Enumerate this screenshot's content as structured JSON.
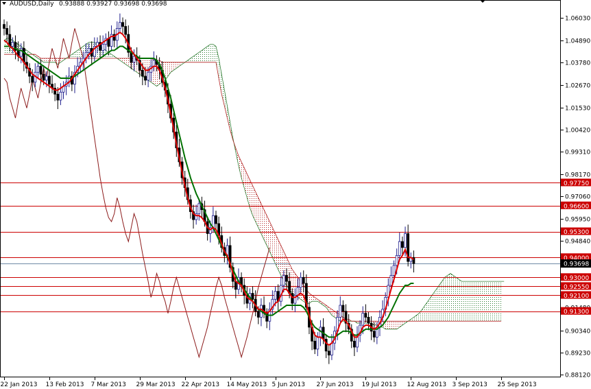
{
  "header": {
    "symbol": "AUDUSD,Daily",
    "ohlc": "0.93888 0.93927 0.93698 0.93698"
  },
  "colors": {
    "background": "#ffffff",
    "axis": "#000000",
    "level_line": "#cc0000",
    "level_label_bg": "#cc0000",
    "current_label_bg": "#000000",
    "current_line": "#6e8aa6",
    "candle_up": "#1c1c8c",
    "candle_down": "#000000",
    "tenkan": "#dd0000",
    "kijun": "#007000",
    "chikou": "#8b1a1a",
    "kumo_bear": "#b22222",
    "kumo_bull": "#2e7d32"
  },
  "chart_data": {
    "type": "candlestick",
    "title": "AUDUSD,Daily",
    "ylim": [
      0.8812,
      1.0672
    ],
    "y_ticks": [
      {
        "v": 1.0603,
        "label": "1.06030"
      },
      {
        "v": 1.0489,
        "label": "1.04890"
      },
      {
        "v": 1.0378,
        "label": "1.03780"
      },
      {
        "v": 1.0267,
        "label": "1.02670"
      },
      {
        "v": 1.0153,
        "label": "1.01530"
      },
      {
        "v": 1.0042,
        "label": "1.00420"
      },
      {
        "v": 0.9931,
        "label": "0.99310"
      },
      {
        "v": 0.9817,
        "label": "0.98170"
      },
      {
        "v": 0.9706,
        "label": "0.97060"
      },
      {
        "v": 0.9595,
        "label": "0.95950"
      },
      {
        "v": 0.9484,
        "label": "0.94840"
      },
      {
        "v": 0.937,
        "label": "0.93700"
      },
      {
        "v": 0.9259,
        "label": "0.92590"
      },
      {
        "v": 0.9148,
        "label": "0.91480"
      },
      {
        "v": 0.9034,
        "label": "0.90340"
      },
      {
        "v": 0.8923,
        "label": "0.89230"
      },
      {
        "v": 0.8812,
        "label": "0.88120"
      }
    ],
    "x_labels": [
      {
        "i": 0,
        "label": "22 Jan 2013"
      },
      {
        "i": 16,
        "label": "13 Feb 2013"
      },
      {
        "i": 32,
        "label": "7 Mar 2013"
      },
      {
        "i": 48,
        "label": "29 Mar 2013"
      },
      {
        "i": 64,
        "label": "22 Apr 2013"
      },
      {
        "i": 80,
        "label": "14 May 2013"
      },
      {
        "i": 96,
        "label": "5 Jun 2013"
      },
      {
        "i": 112,
        "label": "27 Jun 2013"
      },
      {
        "i": 128,
        "label": "19 Jul 2013"
      },
      {
        "i": 144,
        "label": "12 Aug 2013"
      },
      {
        "i": 160,
        "label": "3 Sep 2013"
      },
      {
        "i": 176,
        "label": "25 Sep 2013"
      }
    ],
    "levels": [
      {
        "v": 0.9775,
        "label": "0.97750"
      },
      {
        "v": 0.966,
        "label": "0.96600"
      },
      {
        "v": 0.953,
        "label": "0.95300"
      },
      {
        "v": 0.94,
        "label": "0.94000"
      },
      {
        "v": 0.93,
        "label": "0.93000"
      },
      {
        "v": 0.9255,
        "label": "0.92550"
      },
      {
        "v": 0.921,
        "label": "0.92100"
      },
      {
        "v": 0.913,
        "label": "0.91300"
      }
    ],
    "current": {
      "v": 0.93698,
      "label": "0.93698"
    },
    "closes": [
      1.055,
      1.052,
      1.046,
      1.048,
      1.044,
      1.041,
      1.045,
      1.038,
      1.035,
      1.031,
      1.028,
      1.033,
      1.036,
      1.032,
      1.029,
      1.031,
      1.027,
      1.025,
      1.022,
      1.019,
      1.023,
      1.026,
      1.028,
      1.031,
      1.027,
      1.033,
      1.036,
      1.038,
      1.04,
      1.043,
      1.045,
      1.041,
      1.046,
      1.048,
      1.044,
      1.047,
      1.05,
      1.046,
      1.052,
      1.049,
      1.055,
      1.058,
      1.056,
      1.052,
      1.043,
      1.038,
      1.041,
      1.039,
      1.034,
      1.031,
      1.029,
      1.033,
      1.036,
      1.039,
      1.037,
      1.034,
      1.028,
      1.024,
      1.017,
      1.01,
      1.003,
      0.995,
      0.988,
      0.98,
      0.975,
      0.969,
      0.963,
      0.959,
      0.962,
      0.967,
      0.964,
      0.958,
      0.952,
      0.955,
      0.961,
      0.957,
      0.951,
      0.945,
      0.941,
      0.946,
      0.935,
      0.928,
      0.924,
      0.93,
      0.926,
      0.921,
      0.917,
      0.922,
      0.919,
      0.913,
      0.91,
      0.916,
      0.912,
      0.908,
      0.914,
      0.919,
      0.923,
      0.918,
      0.926,
      0.931,
      0.928,
      0.922,
      0.917,
      0.921,
      0.925,
      0.93,
      0.927,
      0.915,
      0.905,
      0.898,
      0.894,
      0.9,
      0.905,
      0.899,
      0.893,
      0.891,
      0.897,
      0.903,
      0.91,
      0.916,
      0.913,
      0.907,
      0.904,
      0.898,
      0.895,
      0.901,
      0.906,
      0.912,
      0.91,
      0.907,
      0.903,
      0.9,
      0.905,
      0.91,
      0.914,
      0.92,
      0.926,
      0.931,
      0.936,
      0.941,
      0.948,
      0.945,
      0.952,
      0.938,
      0.94,
      0.937
    ],
    "tenkan": [
      1.049,
      1.048,
      1.046,
      1.045,
      1.043,
      1.041,
      1.04,
      1.038,
      1.036,
      1.034,
      1.032,
      1.031,
      1.03,
      1.029,
      1.028,
      1.027,
      1.026,
      1.025,
      1.024,
      1.024,
      1.025,
      1.026,
      1.027,
      1.028,
      1.03,
      1.032,
      1.034,
      1.036,
      1.038,
      1.04,
      1.042,
      1.043,
      1.045,
      1.046,
      1.047,
      1.048,
      1.049,
      1.05,
      1.051,
      1.051,
      1.052,
      1.053,
      1.052,
      1.05,
      1.047,
      1.044,
      1.042,
      1.04,
      1.038,
      1.036,
      1.034,
      1.034,
      1.035,
      1.036,
      1.036,
      1.034,
      1.03,
      1.025,
      1.019,
      1.012,
      1.005,
      0.997,
      0.99,
      0.983,
      0.976,
      0.97,
      0.965,
      0.962,
      0.961,
      0.961,
      0.96,
      0.958,
      0.955,
      0.954,
      0.955,
      0.954,
      0.951,
      0.947,
      0.943,
      0.941,
      0.937,
      0.932,
      0.928,
      0.927,
      0.926,
      0.923,
      0.92,
      0.919,
      0.918,
      0.916,
      0.914,
      0.914,
      0.913,
      0.912,
      0.913,
      0.915,
      0.917,
      0.918,
      0.921,
      0.924,
      0.924,
      0.922,
      0.92,
      0.92,
      0.921,
      0.922,
      0.921,
      0.917,
      0.911,
      0.905,
      0.901,
      0.9,
      0.9,
      0.899,
      0.897,
      0.896,
      0.897,
      0.899,
      0.903,
      0.907,
      0.909,
      0.908,
      0.906,
      0.903,
      0.9,
      0.9,
      0.902,
      0.905,
      0.906,
      0.906,
      0.905,
      0.904,
      0.905,
      0.907,
      0.91,
      0.914,
      0.919,
      0.924,
      0.929,
      0.934,
      0.939,
      0.941,
      0.944,
      0.94,
      0.94,
      0.939
    ],
    "kijun": [
      1.046,
      1.046,
      1.046,
      1.045,
      1.045,
      1.044,
      1.044,
      1.043,
      1.042,
      1.041,
      1.04,
      1.039,
      1.038,
      1.037,
      1.036,
      1.035,
      1.034,
      1.033,
      1.032,
      1.031,
      1.03,
      1.03,
      1.03,
      1.03,
      1.03,
      1.031,
      1.032,
      1.033,
      1.034,
      1.035,
      1.036,
      1.037,
      1.038,
      1.039,
      1.04,
      1.041,
      1.042,
      1.043,
      1.044,
      1.044,
      1.045,
      1.046,
      1.046,
      1.045,
      1.044,
      1.043,
      1.042,
      1.041,
      1.04,
      1.04,
      1.04,
      1.04,
      1.04,
      1.04,
      1.039,
      1.037,
      1.034,
      1.03,
      1.025,
      1.02,
      1.014,
      1.008,
      1.002,
      0.996,
      0.99,
      0.985,
      0.98,
      0.976,
      0.972,
      0.969,
      0.966,
      0.963,
      0.96,
      0.957,
      0.955,
      0.952,
      0.949,
      0.946,
      0.943,
      0.94,
      0.937,
      0.934,
      0.931,
      0.928,
      0.926,
      0.924,
      0.922,
      0.92,
      0.918,
      0.916,
      0.914,
      0.913,
      0.912,
      0.911,
      0.911,
      0.911,
      0.912,
      0.913,
      0.914,
      0.915,
      0.916,
      0.916,
      0.916,
      0.916,
      0.916,
      0.916,
      0.915,
      0.913,
      0.91,
      0.907,
      0.905,
      0.904,
      0.903,
      0.902,
      0.901,
      0.9,
      0.9,
      0.9,
      0.901,
      0.902,
      0.903,
      0.903,
      0.903,
      0.902,
      0.901,
      0.901,
      0.902,
      0.903,
      0.904,
      0.904,
      0.904,
      0.904,
      0.904,
      0.905,
      0.906,
      0.908,
      0.91,
      0.913,
      0.916,
      0.919,
      0.922,
      0.924,
      0.926,
      0.926,
      0.927,
      0.927
    ],
    "chikou": [
      1.03,
      1.028,
      1.02,
      1.015,
      1.01,
      1.018,
      1.025,
      1.02,
      1.015,
      1.022,
      1.03,
      1.025,
      1.02,
      1.028,
      1.035,
      1.03,
      1.038,
      1.045,
      1.04,
      1.035,
      1.042,
      1.05,
      1.045,
      1.04,
      1.048,
      1.055,
      1.05,
      1.045,
      1.04,
      1.03,
      1.02,
      1.01,
      1.0,
      0.99,
      0.98,
      0.972,
      0.965,
      0.96,
      0.958,
      0.962,
      0.97,
      0.965,
      0.958,
      0.952,
      0.948,
      0.955,
      0.962,
      0.958,
      0.95,
      0.942,
      0.935,
      0.928,
      0.92,
      0.925,
      0.932,
      0.928,
      0.922,
      0.918,
      0.912,
      0.918,
      0.925,
      0.93,
      0.925,
      0.92,
      0.915,
      0.91,
      0.905,
      0.9,
      0.895,
      0.89,
      0.895,
      0.9,
      0.905,
      0.912,
      0.918,
      0.925,
      0.93,
      0.926,
      0.92,
      0.915,
      0.91,
      0.905,
      0.9,
      0.895,
      0.89,
      0.895,
      0.9,
      0.906,
      0.912,
      0.918,
      0.925,
      0.93,
      0.935,
      0.94,
      0.945
    ],
    "span_a": [
      1.049,
      1.05,
      1.05,
      1.049,
      1.048,
      1.047,
      1.046,
      1.045,
      1.044,
      1.043,
      1.042,
      1.041,
      1.04,
      1.039,
      1.038,
      1.038,
      1.038,
      1.038,
      1.038,
      1.037,
      1.038,
      1.039,
      1.04,
      1.041,
      1.042,
      1.043,
      1.044,
      1.045,
      1.046,
      1.047,
      1.048,
      1.048,
      1.048,
      1.047,
      1.046,
      1.045,
      1.044,
      1.043,
      1.042,
      1.041,
      1.04,
      1.039,
      1.038,
      1.037,
      1.036,
      1.035,
      1.034,
      1.033,
      1.032,
      1.031,
      1.03,
      1.029,
      1.028,
      1.027,
      1.026,
      1.027,
      1.028,
      1.029,
      1.031,
      1.033,
      1.034,
      1.035,
      1.036,
      1.037,
      1.038,
      1.039,
      1.04,
      1.041,
      1.042,
      1.043,
      1.044,
      1.045,
      1.046,
      1.047,
      1.047,
      1.046,
      1.04,
      1.032,
      1.024,
      1.016,
      1.008,
      1.0,
      0.993,
      0.986,
      0.98,
      0.975,
      0.97,
      0.965,
      0.961,
      0.958,
      0.955,
      0.952,
      0.949,
      0.946,
      0.943,
      0.94,
      0.937,
      0.934,
      0.931,
      0.928,
      0.926,
      0.924,
      0.922,
      0.921,
      0.92,
      0.919,
      0.918,
      0.917,
      0.917,
      0.918,
      0.918,
      0.918,
      0.917,
      0.916,
      0.915,
      0.913,
      0.911,
      0.91,
      0.909,
      0.908,
      0.908,
      0.908,
      0.908,
      0.908,
      0.908,
      0.907,
      0.907,
      0.907,
      0.907,
      0.907,
      0.907,
      0.906,
      0.906,
      0.905,
      0.905,
      0.904,
      0.904,
      0.904,
      0.904,
      0.904,
      0.905,
      0.906,
      0.907,
      0.908,
      0.909,
      0.91,
      0.911,
      0.912,
      0.914,
      0.916,
      0.918,
      0.92,
      0.922,
      0.924,
      0.926,
      0.928,
      0.93,
      0.931,
      0.932,
      0.931,
      0.93,
      0.929,
      0.928,
      0.928,
      0.928,
      0.928,
      0.928,
      0.928,
      0.928,
      0.928,
      0.928,
      0.928,
      0.928,
      0.928,
      0.928,
      0.928,
      0.928,
      0.928
    ],
    "span_b": [
      1.042,
      1.042,
      1.042,
      1.042,
      1.042,
      1.042,
      1.042,
      1.042,
      1.042,
      1.042,
      1.042,
      1.042,
      1.041,
      1.04,
      1.04,
      1.04,
      1.04,
      1.04,
      1.04,
      1.04,
      1.04,
      1.04,
      1.04,
      1.04,
      1.04,
      1.04,
      1.04,
      1.04,
      1.04,
      1.04,
      1.04,
      1.04,
      1.04,
      1.04,
      1.04,
      1.04,
      1.04,
      1.04,
      1.04,
      1.04,
      1.04,
      1.04,
      1.04,
      1.04,
      1.04,
      1.04,
      1.04,
      1.04,
      1.04,
      1.04,
      1.04,
      1.04,
      1.04,
      1.039,
      1.039,
      1.039,
      1.038,
      1.038,
      1.038,
      1.038,
      1.038,
      1.038,
      1.038,
      1.038,
      1.038,
      1.038,
      1.038,
      1.038,
      1.038,
      1.038,
      1.038,
      1.038,
      1.038,
      1.038,
      1.038,
      1.038,
      1.03,
      1.022,
      1.016,
      1.01,
      1.004,
      0.999,
      0.995,
      0.991,
      0.988,
      0.985,
      0.982,
      0.979,
      0.976,
      0.973,
      0.97,
      0.967,
      0.964,
      0.961,
      0.958,
      0.955,
      0.952,
      0.949,
      0.946,
      0.943,
      0.94,
      0.937,
      0.934,
      0.932,
      0.93,
      0.928,
      0.926,
      0.924,
      0.922,
      0.921,
      0.92,
      0.919,
      0.918,
      0.917,
      0.916,
      0.915,
      0.914,
      0.913,
      0.912,
      0.911,
      0.91,
      0.909,
      0.909,
      0.908,
      0.908,
      0.908,
      0.908,
      0.908,
      0.908,
      0.908,
      0.908,
      0.908,
      0.908,
      0.908,
      0.908,
      0.908,
      0.908,
      0.908,
      0.908,
      0.908,
      0.908,
      0.908,
      0.908,
      0.908,
      0.908,
      0.908,
      0.908,
      0.908,
      0.908,
      0.908,
      0.908,
      0.908,
      0.908,
      0.908,
      0.908,
      0.908,
      0.908,
      0.908,
      0.908,
      0.908,
      0.908,
      0.908,
      0.908,
      0.908,
      0.908,
      0.908,
      0.908,
      0.908,
      0.908,
      0.908,
      0.908,
      0.908,
      0.908,
      0.908,
      0.908,
      0.908,
      0.908
    ]
  }
}
